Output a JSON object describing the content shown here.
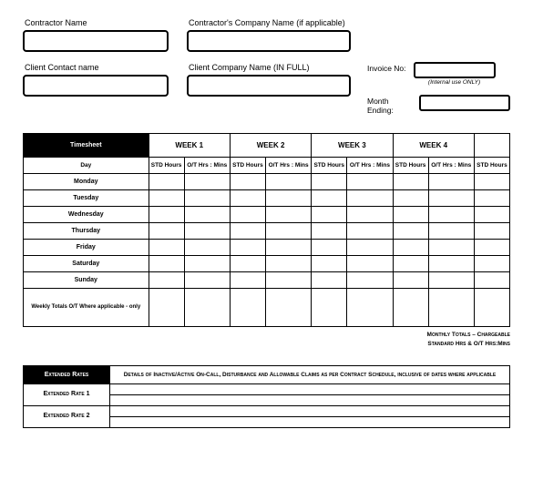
{
  "header": {
    "contractor_name_label": "Contractor Name",
    "contractor_company_label": "Contractor's Company Name (if applicable)",
    "client_contact_label": "Client Contact name",
    "client_company_label": "Client Company Name (IN FULL)",
    "invoice_no_label": "Invoice No:",
    "invoice_no_sub": "(Internal use ONLY)",
    "month_ending_label": "Month Ending:"
  },
  "timesheet": {
    "title": "Timesheet",
    "weeks": [
      "WEEK 1",
      "WEEK 2",
      "WEEK 3",
      "WEEK 4"
    ],
    "day_label": "Day",
    "std_hours_label": "STD Hours",
    "ot_label": "O/T Hrs : Mins",
    "days": [
      "Monday",
      "Tuesday",
      "Wednesday",
      "Thursday",
      "Friday",
      "Saturday",
      "Sunday"
    ],
    "totals_label": "Weekly Totals O/T Where applicable - only",
    "footer_line1": "Monthly Totals – Chargeable",
    "footer_line2": "Standard Hrs & O/T Hrs:Mins"
  },
  "extended": {
    "title": "Extended Rates",
    "details": "Details of Inactive/Active On-Call, Disturbance and Allowable Claims as per Contract Schedule, inclusive of dates where applicable",
    "rate1": "Extended Rate 1",
    "rate2": "Extended Rate 2"
  }
}
